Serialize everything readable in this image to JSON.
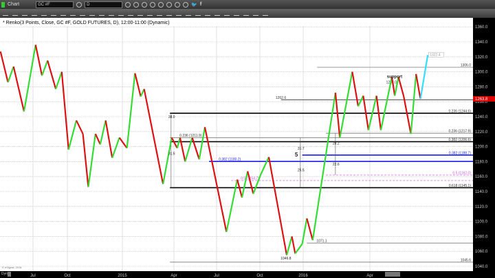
{
  "window": {
    "title": "Chart",
    "symbol": "GC #F",
    "interval": "D"
  },
  "chart_header": "* Renko(3 Points, Close, GC #F, GOLD FUTURES, D), 12:00-11:00 (Dynamic)",
  "watermark": "© eSignal, 2016",
  "bottom_label": "Dyn",
  "colors": {
    "up": "#33dd33",
    "down": "#dd1111",
    "projection": "#33ddff",
    "fib_blue": "#1a1aee",
    "fib_magenta": "#dd88ee",
    "last_price_bg": "#dd0000"
  },
  "chart_data": {
    "type": "line",
    "title": "",
    "xlabel": "",
    "ylabel": "",
    "ylim": [
      1035,
      1375
    ],
    "yticks": [
      1040,
      1060,
      1080,
      1100,
      1120,
      1140,
      1160,
      1180,
      1200,
      1220,
      1240,
      1260,
      1280,
      1300,
      1320,
      1340,
      1360
    ],
    "ytick_labels": [
      "1040.0",
      "1060.0",
      "1080.0",
      "1100.0",
      "1120.0",
      "1140.0",
      "1160.0",
      "1180.0",
      "1200.0",
      "1220.0",
      "1240.0",
      "1260.0",
      "1280.0",
      "1300.0",
      "1320.0",
      "1340.0",
      "1360.0"
    ],
    "xticks": [
      {
        "label": "Jul",
        "date": "2014-07-01"
      },
      {
        "label": "Oct",
        "date": "2014-10-01"
      },
      {
        "label": "2015",
        "date": "2015-01-01"
      },
      {
        "label": "Apr",
        "date": "2015-04-01"
      },
      {
        "label": "Jul",
        "date": "2015-07-01"
      },
      {
        "label": "Oct",
        "date": "2015-10-01"
      },
      {
        "label": "2016",
        "date": "2016-01-01"
      },
      {
        "label": "Apr",
        "date": "2016-04-01"
      }
    ],
    "grid": true,
    "series": [
      {
        "swings": [
          [
            "2014-04-05",
            1327
          ],
          [
            "2014-04-25",
            1286
          ],
          [
            "2014-05-10",
            1307
          ],
          [
            "2014-06-07",
            1247
          ],
          [
            "2014-07-08",
            1336
          ],
          [
            "2014-07-25",
            1295
          ],
          [
            "2014-08-09",
            1315
          ],
          [
            "2014-08-31",
            1277
          ],
          [
            "2014-09-16",
            1300
          ],
          [
            "2014-10-03",
            1196
          ],
          [
            "2014-10-16",
            1235
          ],
          [
            "2014-10-27",
            1217
          ],
          [
            "2014-11-05",
            1146
          ],
          [
            "2014-11-17",
            1217
          ],
          [
            "2014-11-25",
            1203
          ],
          [
            "2014-12-04",
            1235
          ],
          [
            "2014-12-15",
            1185
          ],
          [
            "2014-12-27",
            1212
          ],
          [
            "2015-01-09",
            1198
          ],
          [
            "2015-01-23",
            1298
          ],
          [
            "2015-02-02",
            1267
          ],
          [
            "2015-02-08",
            1277
          ],
          [
            "2015-03-13",
            1150
          ],
          [
            "2015-03-28",
            1212
          ],
          [
            "2015-04-08",
            1198
          ],
          [
            "2015-04-14",
            1212
          ],
          [
            "2015-04-25",
            1180
          ],
          [
            "2015-05-10",
            1212
          ],
          [
            "2015-05-25",
            1183
          ],
          [
            "2015-06-06",
            1226
          ],
          [
            "2015-06-12",
            1208
          ],
          [
            "2015-07-22",
            1086
          ],
          [
            "2015-08-14",
            1156
          ],
          [
            "2015-08-24",
            1132
          ],
          [
            "2015-09-05",
            1167
          ],
          [
            "2015-09-17",
            1137
          ],
          [
            "2015-10-03",
            1163
          ],
          [
            "2015-10-20",
            1186
          ],
          [
            "2015-11-27",
            1055
          ],
          [
            "2015-12-08",
            1080
          ],
          [
            "2015-12-15",
            1057
          ],
          [
            "2015-12-30",
            1070
          ],
          [
            "2016-01-06",
            1104
          ],
          [
            "2016-01-14",
            1075
          ],
          [
            "2016-02-14",
            1272
          ],
          [
            "2016-02-20",
            1212
          ],
          [
            "2016-03-08",
            1300
          ],
          [
            "2016-03-16",
            1254
          ],
          [
            "2016-03-23",
            1268
          ],
          [
            "2016-03-30",
            1222
          ],
          [
            "2016-04-10",
            1268
          ],
          [
            "2016-04-16",
            1222
          ],
          [
            "2016-05-01",
            1293
          ],
          [
            "2016-05-05",
            1268
          ],
          [
            "2016-05-10",
            1293
          ],
          [
            "2016-05-17",
            1268
          ],
          [
            "2016-05-27",
            1217
          ],
          [
            "2016-06-03",
            1297
          ],
          [
            "2016-06-09",
            1263.8
          ]
        ]
      },
      {
        "name": "projection",
        "swings": [
          [
            "2016-06-09",
            1263.8
          ],
          [
            "2016-06-19",
            1322.4
          ]
        ]
      }
    ],
    "last_price": "1263.8",
    "projection_label": "1322.4",
    "levels": [
      {
        "value": 1306.0,
        "label": "1306.0",
        "from": "2016-01-20",
        "color": "#999999"
      },
      {
        "value": 1262.6,
        "label": "1262.6",
        "from": "2015-11-15",
        "color": "#444444"
      },
      {
        "value": 1283.0,
        "label": "1283.0",
        "from": "2016-04-10",
        "color": "none"
      },
      {
        "value": 1244.6,
        "label": "0.236 (1244.6)",
        "from": "2015-03-25",
        "color": "#000000"
      },
      {
        "value": 1217.9,
        "label": "0.236 (1217.9)",
        "from": "2016-02-01",
        "color": "#888888"
      },
      {
        "value": 1211.9,
        "label": "0.236 (1211.9)",
        "from": "2015-03-25",
        "color": "#888888"
      },
      {
        "value": 1206.6,
        "label": "0.382 (1206.6)",
        "from": "2015-03-25",
        "color": "#000000"
      },
      {
        "value": 1188.7,
        "label": "0.382 (1188.7)",
        "from": "2015-12-30",
        "color": "#1a1aee"
      },
      {
        "value": 1180.2,
        "label": "0.382 (1180.2)",
        "from": "2015-06-15",
        "color": "#1a1aee"
      },
      {
        "value": 1162.0,
        "label": "0.5 (1162.0)",
        "from": "2016-02-01",
        "color": "#dd88ee"
      },
      {
        "value": 1154.7,
        "label": "0.5 (1154.7)",
        "from": "2015-08-01",
        "color": "#dd88ee"
      },
      {
        "value": 1145.1,
        "label": "0.618 (1145.1)",
        "from": "2015-03-25",
        "color": "#000000"
      },
      {
        "value": 1071.1,
        "label": "1071.1",
        "from": "2016-01-06",
        "color": "#888888"
      },
      {
        "value": 1045.6,
        "label": "1045.6",
        "from": "2015-03-25",
        "color": "#888888"
      }
    ],
    "annotations": [
      {
        "text": "support",
        "date": "2016-04-28",
        "value": 1292
      },
      {
        "text": "1046.8",
        "date": "2015-11-20",
        "value": 1049
      },
      {
        "text": "38.0",
        "date": "2015-03-27",
        "value": 1238
      },
      {
        "text": "31.5",
        "date": "2015-03-27",
        "value": 1189
      },
      {
        "text": "31.7",
        "date": "2015-12-26",
        "value": 1196
      },
      {
        "text": "5",
        "date": "2015-12-26",
        "value": 1187
      },
      {
        "text": "25.5",
        "date": "2015-12-26",
        "value": 1167
      },
      {
        "text": "28.2",
        "date": "2016-02-14",
        "value": 1203
      },
      {
        "text": "22.6",
        "date": "2016-02-14",
        "value": 1175
      }
    ]
  }
}
